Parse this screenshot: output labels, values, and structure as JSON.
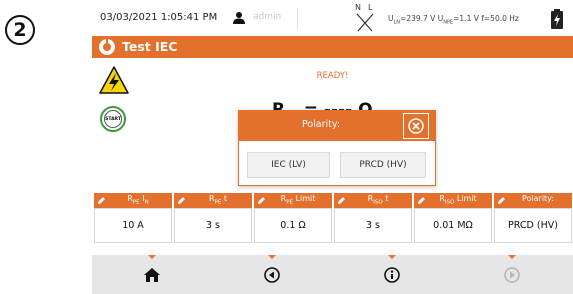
{
  "step_number": "2",
  "status_bar": {
    "datetime": "03/03/2021 1:05:41 PM",
    "user": "admin",
    "phase_labels": {
      "n": "N",
      "l": "L"
    },
    "voltages": {
      "uln_label": "U",
      "uln_sub": "LN",
      "uln_value": "=239.7 V",
      "unpe_label": "U",
      "unpe_sub": "NPE",
      "unpe_value": "=1.1 V",
      "freq": "f=50.0 Hz"
    }
  },
  "title": "Test IEC",
  "status_text": "READY!",
  "result": {
    "symbol": "R",
    "sub": "PE",
    "value": " = ---- Ω"
  },
  "start_label": "START",
  "dialog": {
    "title": "Polarity:",
    "options": [
      "IEC (LV)",
      "PRCD (HV)"
    ]
  },
  "params": [
    {
      "label": "R",
      "label_sub": "PE",
      "label_tail": " I",
      "label_tail_sub": "N",
      "value": "10 A"
    },
    {
      "label": "R",
      "label_sub": "PE",
      "label_tail": " t",
      "label_tail_sub": "",
      "value": "3 s"
    },
    {
      "label": "R",
      "label_sub": "PE",
      "label_tail": " Limit",
      "label_tail_sub": "",
      "value": "0.1 Ω"
    },
    {
      "label": "R",
      "label_sub": "ISO",
      "label_tail": " t",
      "label_tail_sub": "",
      "value": "3 s"
    },
    {
      "label": "R",
      "label_sub": "ISO",
      "label_tail": " Limit",
      "label_tail_sub": "",
      "value": "0.01 MΩ"
    },
    {
      "label": "Polarity:",
      "label_sub": "",
      "label_tail": "",
      "label_tail_sub": "",
      "value": "PRCD (HV)"
    }
  ],
  "nav": [
    "home-icon",
    "back-icon",
    "info-icon",
    "next-icon"
  ],
  "colors": {
    "accent": "#e4702e",
    "start_ring": "#3a9c3a",
    "nav_bg": "#e6e6e6"
  }
}
